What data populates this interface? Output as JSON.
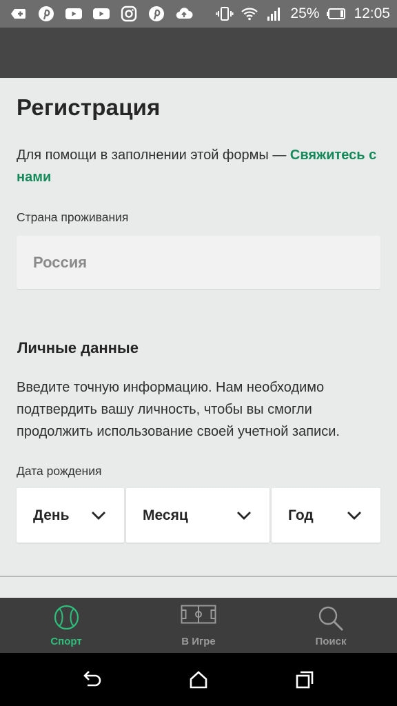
{
  "status_bar": {
    "battery": "25%",
    "time": "12:05",
    "left_icons": [
      "add-box-icon",
      "pinterest-icon",
      "youtube-icon",
      "youtube-icon",
      "instagram-icon",
      "pinterest-icon",
      "cloud-upload-icon"
    ],
    "right_icons": [
      "vibrate-icon",
      "wifi-icon",
      "signal-icon",
      "battery-icon"
    ]
  },
  "page": {
    "title": "Регистрация",
    "help_prefix": "Для помощи в заполнении этой формы — ",
    "help_link": "Свяжитесь с нами"
  },
  "country": {
    "label": "Страна проживания",
    "value": "Россия"
  },
  "personal": {
    "title": "Личные данные",
    "description": "Введите точную информацию. Нам необходимо подтвердить вашу личность, чтобы вы смогли продолжить использование своей учетной записи."
  },
  "dob": {
    "label": "Дата рождения",
    "day": "День",
    "month": "Месяц",
    "year": "Год"
  },
  "bottom_nav": {
    "items": [
      {
        "label": "Спорт",
        "icon": "sport-ball-icon",
        "active": true
      },
      {
        "label": "В Игре",
        "icon": "field-icon",
        "active": false
      },
      {
        "label": "Поиск",
        "icon": "search-icon",
        "active": false
      }
    ]
  },
  "colors": {
    "accent": "#148a5b",
    "active_nav": "#2cc07c",
    "inactive_nav": "#9a9a9a"
  }
}
